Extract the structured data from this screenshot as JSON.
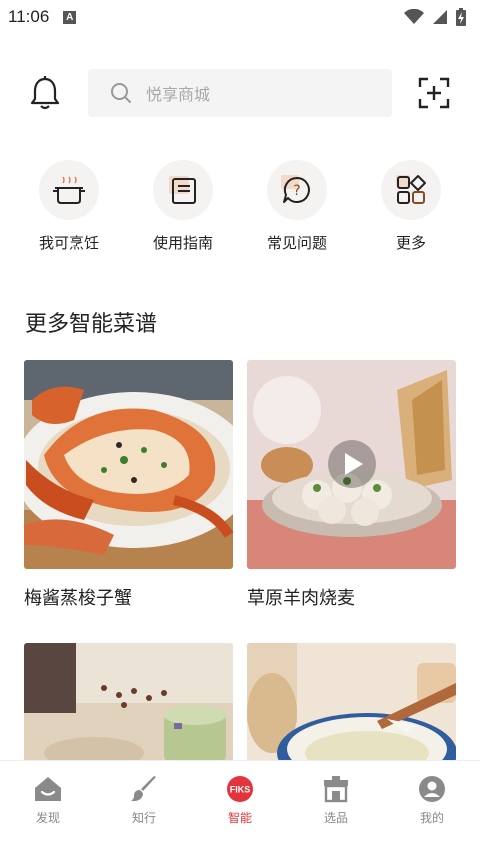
{
  "status_bar": {
    "time": "11:06",
    "notification_badge": "A"
  },
  "search": {
    "placeholder": "悦享商城"
  },
  "quick_actions": [
    {
      "label": "我可烹饪",
      "icon": "pot-icon"
    },
    {
      "label": "使用指南",
      "icon": "book-icon"
    },
    {
      "label": "常见问题",
      "icon": "question-bubble-icon"
    },
    {
      "label": "更多",
      "icon": "grid-more-icon"
    }
  ],
  "section": {
    "title": "更多智能菜谱"
  },
  "recipes": [
    {
      "title": "梅酱蒸梭子蟹",
      "has_video": false
    },
    {
      "title": "草原羊肉烧麦",
      "has_video": true
    },
    {
      "title": "",
      "has_video": false
    },
    {
      "title": "",
      "has_video": false
    }
  ],
  "tabbar": {
    "tabs": [
      {
        "label": "发现",
        "icon": "house-icon",
        "active": false
      },
      {
        "label": "知行",
        "icon": "brush-icon",
        "active": false
      },
      {
        "label": "智能",
        "icon": "fiks-logo-icon",
        "active": true,
        "logo_text": "FIKS"
      },
      {
        "label": "选品",
        "icon": "store-icon",
        "active": false
      },
      {
        "label": "我的",
        "icon": "profile-icon",
        "active": false
      }
    ]
  },
  "colors": {
    "accent": "#e5333b",
    "icon_gray": "#888888"
  }
}
